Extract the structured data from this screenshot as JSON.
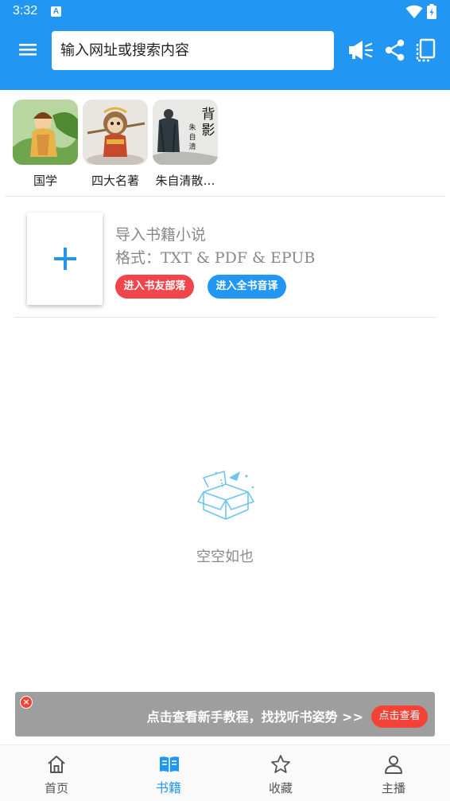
{
  "status_bar": {
    "time": "3:32",
    "notification_letter": "A"
  },
  "toolbar": {
    "search_placeholder": "输入网址或搜索内容"
  },
  "categories": [
    {
      "label": "国学"
    },
    {
      "label": "四大名著"
    },
    {
      "label": "朱自清散…",
      "cover_title": "背影",
      "cover_author": "朱自清"
    }
  ],
  "import": {
    "title": "导入书籍小说",
    "format": "格式：TXT & PDF & EPUB",
    "tribe_button": "进入书友部落",
    "translate_button": "进入全书音译"
  },
  "empty_state": {
    "text": "空空如也"
  },
  "banner": {
    "message": "点击查看新手教程，找找听书姿势 >>",
    "button": "点击查看"
  },
  "bottom_nav": [
    {
      "label": "首页",
      "active": false
    },
    {
      "label": "书籍",
      "active": true
    },
    {
      "label": "收藏",
      "active": false
    },
    {
      "label": "主播",
      "active": false
    }
  ],
  "colors": {
    "primary": "#2196f3",
    "accent_red": "#f0454a",
    "banner_bg": "#9e9e9e"
  }
}
